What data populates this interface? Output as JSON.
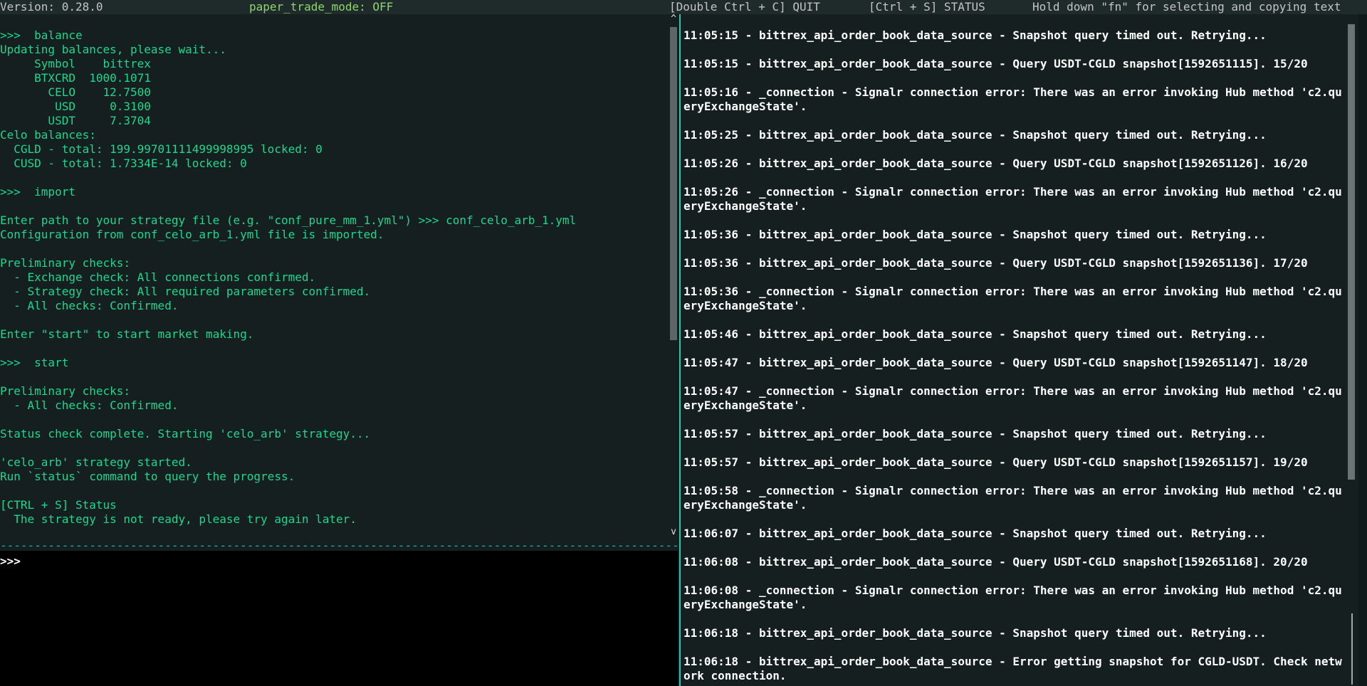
{
  "topbar": {
    "version": "Version: 0.28.0",
    "paper_trade_mode": "paper_trade_mode: OFF",
    "quit_hint": "[Double Ctrl + C] QUIT",
    "status_hint": "[Ctrl + S] STATUS",
    "fn_hint": "Hold down \"fn\" for selecting and copying text"
  },
  "output": {
    "lines": [
      ">>>  balance",
      "Updating balances, please wait...",
      "     Symbol    bittrex",
      "     BTXCRD  1000.1071",
      "       CELO    12.7500",
      "        USD     0.3100",
      "       USDT     7.3704",
      "Celo balances:",
      "  CGLD - total: 199.99701111499998995 locked: 0",
      "  CUSD - total: 1.7334E-14 locked: 0",
      "",
      ">>>  import",
      "",
      "Enter path to your strategy file (e.g. \"conf_pure_mm_1.yml\") >>> conf_celo_arb_1.yml",
      "Configuration from conf_celo_arb_1.yml file is imported.",
      "",
      "Preliminary checks:",
      "  - Exchange check: All connections confirmed.",
      "  - Strategy check: All required parameters confirmed.",
      "  - All checks: Confirmed.",
      "",
      "Enter \"start\" to start market making.",
      "",
      ">>>  start",
      "",
      "Preliminary checks:",
      "  - All checks: Confirmed.",
      "",
      "Status check complete. Starting 'celo_arb' strategy...",
      "",
      "'celo_arb' strategy started.",
      "Run `status` command to query the progress.",
      "",
      "[CTRL + S] Status",
      "  The strategy is not ready, please try again later."
    ]
  },
  "scroll": {
    "up_arrow": "^",
    "down_arrow": "v"
  },
  "divider_text": "---------------------------------------------------------------------------------------------------------------------------",
  "input": {
    "prompt": ">>>",
    "value": "",
    "placeholder": ""
  },
  "log": {
    "entries": [
      "11:05:15 - bittrex_api_order_book_data_source - Snapshot query timed out. Retrying...",
      "11:05:15 - bittrex_api_order_book_data_source - Query USDT-CGLD snapshot[1592651115]. 15/20",
      "11:05:16 - _connection - Signalr connection error: There was an error invoking Hub method 'c2.queryExchangeState'.",
      "11:05:25 - bittrex_api_order_book_data_source - Snapshot query timed out. Retrying...",
      "11:05:26 - bittrex_api_order_book_data_source - Query USDT-CGLD snapshot[1592651126]. 16/20",
      "11:05:26 - _connection - Signalr connection error: There was an error invoking Hub method 'c2.queryExchangeState'.",
      "11:05:36 - bittrex_api_order_book_data_source - Snapshot query timed out. Retrying...",
      "11:05:36 - bittrex_api_order_book_data_source - Query USDT-CGLD snapshot[1592651136]. 17/20",
      "11:05:36 - _connection - Signalr connection error: There was an error invoking Hub method 'c2.queryExchangeState'.",
      "11:05:46 - bittrex_api_order_book_data_source - Snapshot query timed out. Retrying...",
      "11:05:47 - bittrex_api_order_book_data_source - Query USDT-CGLD snapshot[1592651147]. 18/20",
      "11:05:47 - _connection - Signalr connection error: There was an error invoking Hub method 'c2.queryExchangeState'.",
      "11:05:57 - bittrex_api_order_book_data_source - Snapshot query timed out. Retrying...",
      "11:05:57 - bittrex_api_order_book_data_source - Query USDT-CGLD snapshot[1592651157]. 19/20",
      "11:05:58 - _connection - Signalr connection error: There was an error invoking Hub method 'c2.queryExchangeState'.",
      "11:06:07 - bittrex_api_order_book_data_source - Snapshot query timed out. Retrying...",
      "11:06:08 - bittrex_api_order_book_data_source - Query USDT-CGLD snapshot[1592651168]. 20/20",
      "11:06:08 - _connection - Signalr connection error: There was an error invoking Hub method 'c2.queryExchangeState'.",
      "11:06:18 - bittrex_api_order_book_data_source - Snapshot query timed out. Retrying...",
      "11:06:18 - bittrex_api_order_book_data_source - Error getting snapshot for CGLD-USDT. Check network connection."
    ]
  },
  "colors": {
    "output_text": "#1fd68f",
    "paper_mode": "#8fd56c",
    "log_text": "#ffffff",
    "separator": "#1ecfb6"
  }
}
